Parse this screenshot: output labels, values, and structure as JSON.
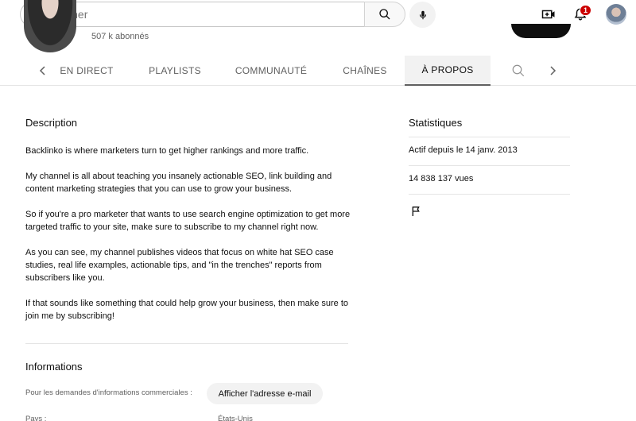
{
  "search": {
    "placeholder": "Rechercher"
  },
  "topbar": {
    "notification_count": "1",
    "icons": [
      "search-icon",
      "microphone-icon",
      "create-video-icon",
      "bell-icon",
      "avatar"
    ]
  },
  "channel": {
    "subscribers": "507 k abonnés"
  },
  "tabs": {
    "items": [
      {
        "label": "EN DIRECT"
      },
      {
        "label": "PLAYLISTS"
      },
      {
        "label": "COMMUNAUTÉ"
      },
      {
        "label": "CHAÎNES"
      },
      {
        "label": "À PROPOS"
      }
    ],
    "active": "À PROPOS"
  },
  "description": {
    "title": "Description",
    "paragraphs": [
      "Backlinko is where marketers turn to get higher rankings and more traffic.",
      "My channel is all about teaching you insanely actionable SEO, link building and content marketing strategies that you can use to grow your business.",
      "So if you're a pro marketer that wants to use search engine optimization to get more targeted traffic to your site, make sure to subscribe to my channel right now.",
      "As you can see, my channel publishes videos that focus on white hat SEO case studies, real life examples, actionable tips, and \"in the trenches\" reports from subscribers like you.",
      "If that sounds like something that could help grow your business, then make sure to join me by subscribing!"
    ]
  },
  "informations": {
    "title": "Informations",
    "business_label": "Pour les demandes d'informations commerciales :",
    "email_button": "Afficher l'adresse e-mail",
    "country_label": "Pays :",
    "country_value": "États-Unis"
  },
  "statistics": {
    "title": "Statistiques",
    "joined": "Actif depuis le 14 janv. 2013",
    "views": "14 838 137 vues"
  },
  "colors": {
    "accent_badge": "#cc0000",
    "text_primary": "#0f0f0f",
    "text_secondary": "#606060",
    "tab_active_bg": "#f2f2f2"
  }
}
